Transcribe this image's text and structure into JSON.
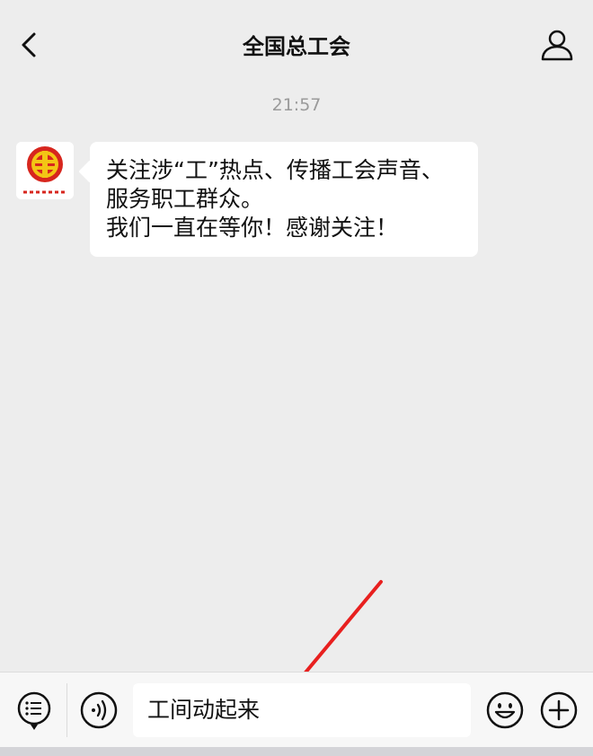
{
  "header": {
    "title": "全国总工会",
    "back_icon": "chevron-left-icon",
    "profile_icon": "person-icon"
  },
  "chat": {
    "timestamp": "21:57",
    "messages": [
      {
        "sender": "全国总工会",
        "avatar_icon": "trade-union-logo",
        "lines": [
          "关注涉“工”热点、传播工会声音、",
          "服务职工群众。",
          "我们一直在等你！感谢关注！"
        ]
      }
    ]
  },
  "input_bar": {
    "menu_icon": "menu-list-icon",
    "voice_icon": "voice-icon",
    "text_value": "工间动起来",
    "emoji_icon": "emoji-icon",
    "plus_icon": "plus-icon"
  },
  "colors": {
    "background": "#ededed",
    "bubble": "#ffffff",
    "arrow": "#e8201f",
    "logo_red": "#d7261e",
    "logo_gold": "#f3c515"
  }
}
